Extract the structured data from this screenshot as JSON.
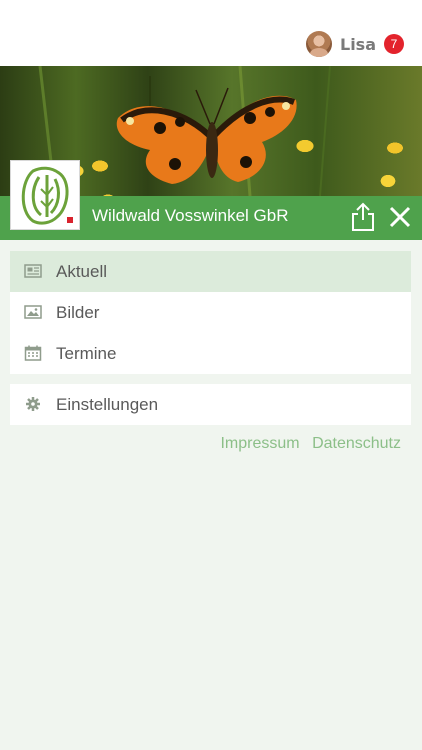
{
  "user": {
    "name": "Lisa",
    "notification_count": "7"
  },
  "header": {
    "title": "Wildwald Vosswinkel GbR"
  },
  "menu": {
    "primary": [
      {
        "label": "Aktuell",
        "icon": "newspaper-icon",
        "active": true
      },
      {
        "label": "Bilder",
        "icon": "image-icon",
        "active": false
      },
      {
        "label": "Termine",
        "icon": "calendar-icon",
        "active": false
      }
    ],
    "secondary": [
      {
        "label": "Einstellungen",
        "icon": "gear-icon",
        "active": false
      }
    ]
  },
  "footer": {
    "impressum": "Impressum",
    "datenschutz": "Datenschutz"
  },
  "colors": {
    "accent_green": "#4fa24c",
    "active_item_bg": "#dcebdb",
    "page_bg": "#f0f5ef",
    "link_green": "#8cbf88",
    "badge_red": "#e3232c"
  }
}
